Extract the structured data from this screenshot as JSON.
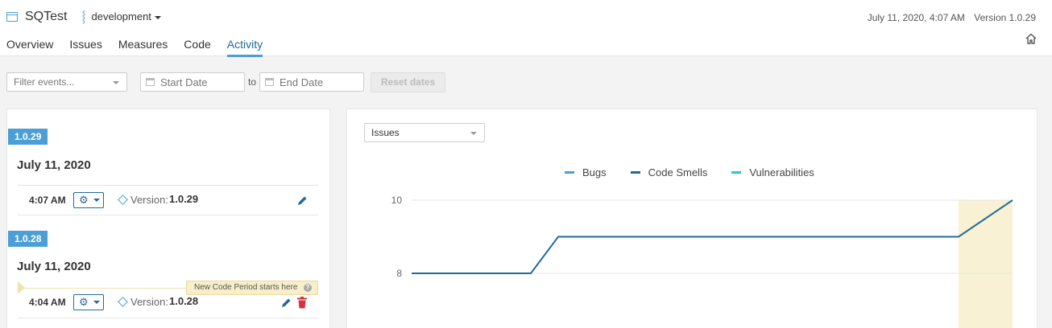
{
  "header": {
    "project_name": "SQTest",
    "branch": "development",
    "datetime": "July 11, 2020, 4:07 AM",
    "version": "Version 1.0.29",
    "tabs": [
      {
        "label": "Overview",
        "active": false
      },
      {
        "label": "Issues",
        "active": false
      },
      {
        "label": "Measures",
        "active": false
      },
      {
        "label": "Code",
        "active": false
      },
      {
        "label": "Activity",
        "active": true
      }
    ],
    "icons": [
      "project-icon",
      "branch-icon",
      "home-icon"
    ]
  },
  "filters": {
    "events_placeholder": "Filter events...",
    "start_placeholder": "Start Date",
    "to_label": "to",
    "end_placeholder": "End Date",
    "reset_label": "Reset dates"
  },
  "activity": {
    "groups": [
      {
        "version_tag": "1.0.29",
        "date": "July 11, 2020",
        "event": {
          "time": "4:07 AM",
          "label": "Version:",
          "value": "1.0.29",
          "actions": [
            "edit"
          ]
        }
      },
      {
        "version_tag": "1.0.28",
        "date": "July 11, 2020",
        "event": {
          "time": "4:04 AM",
          "label": "Version:",
          "value": "1.0.28",
          "actions": [
            "edit",
            "delete"
          ]
        }
      }
    ],
    "new_code_period_text": "New Code Period starts here",
    "help_glyph": "?"
  },
  "chart_panel": {
    "graph_select": "Issues",
    "colors": {
      "bugs": "#4b9fd5",
      "code_smells": "#236a97",
      "vulnerabilities": "#24c6e0",
      "new_code_band": "#f8f1d4"
    }
  },
  "chart_data": {
    "type": "line",
    "title": "",
    "xlabel": "",
    "ylabel": "",
    "legend_position": "top",
    "series": [
      {
        "name": "Bugs",
        "values": []
      },
      {
        "name": "Code Smells",
        "values": [
          8,
          8,
          9,
          9,
          10
        ]
      },
      {
        "name": "Vulnerabilities",
        "values": []
      }
    ],
    "y_ticks": [
      "10",
      "8"
    ],
    "ylim": [
      7.5,
      10
    ]
  }
}
